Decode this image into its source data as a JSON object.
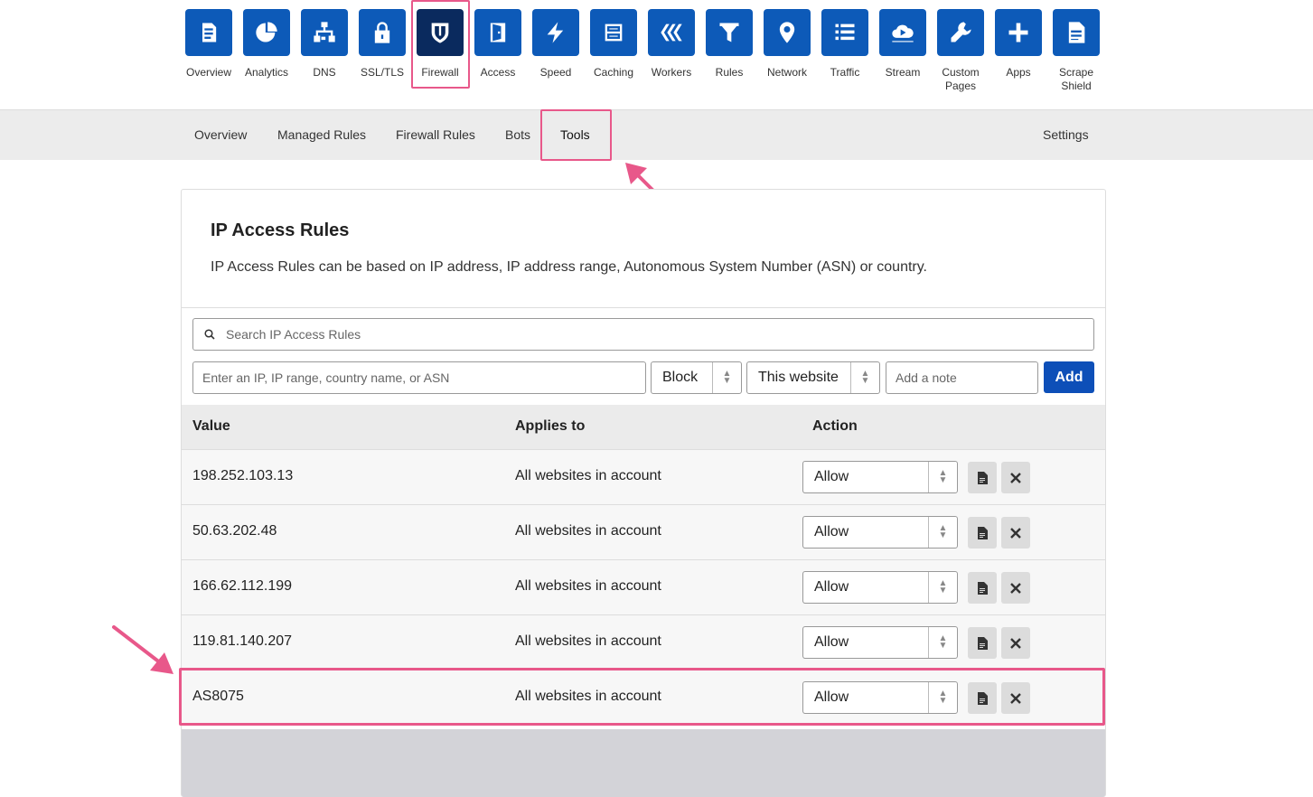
{
  "top_nav": {
    "items": [
      {
        "label": "Overview",
        "icon": "clipboard-icon"
      },
      {
        "label": "Analytics",
        "icon": "pie-chart-icon"
      },
      {
        "label": "DNS",
        "icon": "network-tree-icon"
      },
      {
        "label": "SSL/TLS",
        "icon": "lock-icon"
      },
      {
        "label": "Firewall",
        "icon": "shield-icon"
      },
      {
        "label": "Access",
        "icon": "door-icon"
      },
      {
        "label": "Speed",
        "icon": "lightning-icon"
      },
      {
        "label": "Caching",
        "icon": "server-icon"
      },
      {
        "label": "Workers",
        "icon": "workers-icon"
      },
      {
        "label": "Rules",
        "icon": "filter-icon"
      },
      {
        "label": "Network",
        "icon": "location-pin-icon"
      },
      {
        "label": "Traffic",
        "icon": "list-icon"
      },
      {
        "label": "Stream",
        "icon": "cloud-play-icon"
      },
      {
        "label": "Custom Pages",
        "icon": "wrench-icon"
      },
      {
        "label": "Apps",
        "icon": "plus-icon"
      },
      {
        "label": "Scrape Shield",
        "icon": "document-icon"
      }
    ],
    "active": "Firewall",
    "accent_color": "#0d5ab8",
    "active_color": "#0a2a5e"
  },
  "sub_nav": {
    "tabs": [
      "Overview",
      "Managed Rules",
      "Firewall Rules",
      "Bots",
      "Tools"
    ],
    "active": "Tools",
    "settings_label": "Settings"
  },
  "ip_access": {
    "title": "IP Access Rules",
    "description": "IP Access Rules can be based on IP address, IP address range, Autonomous System Number (ASN) or country.",
    "search_placeholder": "Search IP Access Rules",
    "ip_placeholder": "Enter an IP, IP range, country name, or ASN",
    "action_value": "Block",
    "scope_value": "This website",
    "note_placeholder": "Add a note",
    "add_label": "Add",
    "columns": [
      "Value",
      "Applies to",
      "Action"
    ],
    "rows": [
      {
        "value": "198.252.103.13",
        "applies_to": "All websites in account",
        "action": "Allow"
      },
      {
        "value": "50.63.202.48",
        "applies_to": "All websites in account",
        "action": "Allow"
      },
      {
        "value": "166.62.112.199",
        "applies_to": "All websites in account",
        "action": "Allow"
      },
      {
        "value": "119.81.140.207",
        "applies_to": "All websites in account",
        "action": "Allow"
      },
      {
        "value": "AS8075",
        "applies_to": "All websites in account",
        "action": "Allow"
      }
    ]
  },
  "annotation_color": "#e8588a"
}
